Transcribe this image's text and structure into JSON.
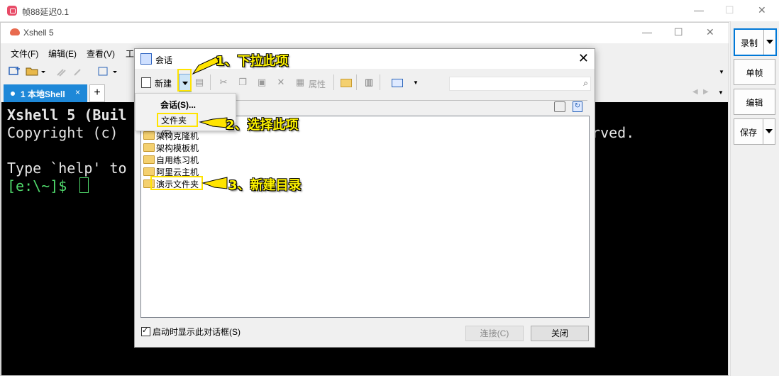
{
  "outer_window": {
    "title": "帧88延迟0.1"
  },
  "recorder": {
    "record": "录制",
    "single_frame": "单帧",
    "edit": "编辑",
    "save": "保存"
  },
  "xshell": {
    "title": "Xshell 5",
    "menu": [
      "文件(F)",
      "编辑(E)",
      "查看(V)",
      "工"
    ],
    "tab": {
      "label": "1 本地Shell",
      "close": "×",
      "add": "+"
    },
    "terminal": {
      "line1": "Xshell 5 (Buil",
      "line2": "Copyright (c) ",
      "line2_tail": "erved.",
      "line3": "Type `help' to",
      "prompt": "[e:\\~]$ "
    }
  },
  "dialog": {
    "title": "会话",
    "toolbar": {
      "new": "新建",
      "properties": "属性"
    },
    "dropdown": {
      "session": "会话(S)...",
      "folder": "文件夹(F)"
    },
    "items": [
      "架构克隆机",
      "架构模板机",
      "自用练习机",
      "阿里云主机",
      "演示文件夹"
    ],
    "show_on_startup": "启动时显示此对话框(S)",
    "connect": "连接(C)",
    "close": "关闭"
  },
  "annotations": {
    "step1": "1、下拉此项",
    "step2": "2、选择此项",
    "step3": "3、新建目录"
  },
  "colors": {
    "accent": "#1e88d8",
    "highlight": "#ffe400",
    "prompt": "#4fd86b"
  }
}
